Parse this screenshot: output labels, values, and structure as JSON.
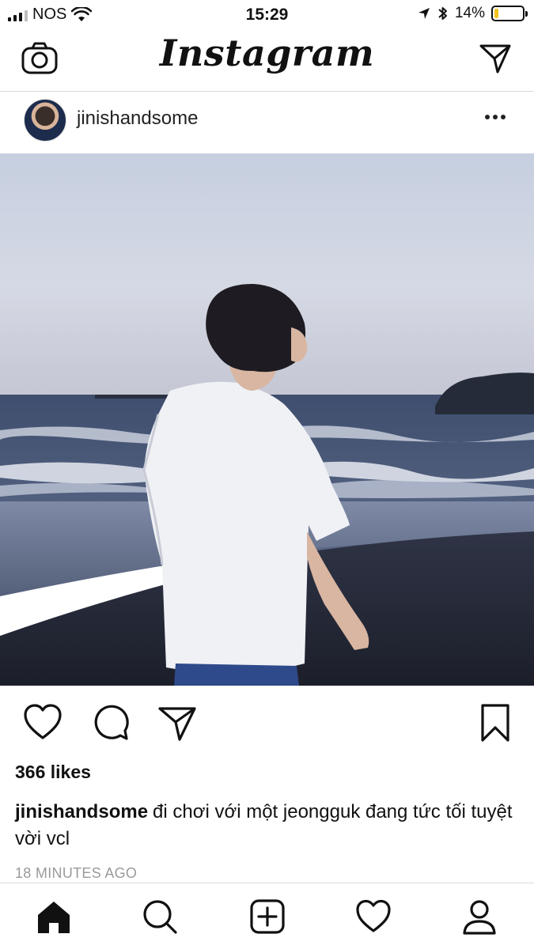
{
  "status_bar": {
    "carrier": "NOS",
    "time": "15:29",
    "battery": "14%",
    "battery_level": 0.14,
    "icons": [
      "signal-icon",
      "wifi-icon",
      "location-icon",
      "bluetooth-icon",
      "battery-icon"
    ]
  },
  "header": {
    "logo": "Instagram",
    "icons": [
      "camera-icon",
      "direct-message-icon"
    ]
  },
  "post": {
    "username": "jinishandsome",
    "likes": "366 likes",
    "caption_user": "jinishandsome",
    "caption_text": "đi chơi với một jeongguk đang tức tối tuyệt vời vcl",
    "time_ago": "18 MINUTES AGO",
    "action_icons": [
      "heart-icon",
      "comment-icon",
      "share-icon",
      "bookmark-icon"
    ]
  },
  "bottom_nav": {
    "items": [
      "home-icon",
      "search-icon",
      "add-post-icon",
      "activity-heart-icon",
      "profile-icon"
    ],
    "active": "home-icon"
  },
  "colors": {
    "text": "#111111",
    "muted": "#9a9a9a",
    "divider": "#dbdbdb",
    "battery_fill": "#f4c21f"
  }
}
